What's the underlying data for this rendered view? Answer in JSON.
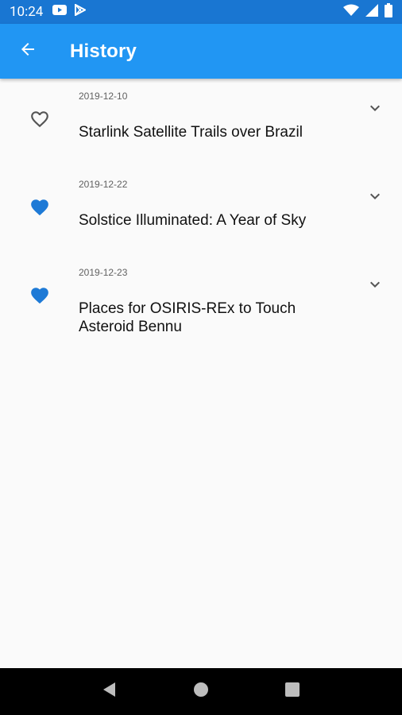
{
  "status_bar": {
    "time": "10:24",
    "left_icons": [
      "youtube-icon",
      "play-store-icon"
    ],
    "right_icons": [
      "wifi-icon",
      "signal-icon",
      "battery-icon"
    ]
  },
  "app_bar": {
    "title": "History",
    "back_icon": "arrow-back-icon",
    "color": "#2196f3"
  },
  "history": [
    {
      "date": "2019-12-10",
      "title": "Starlink Satellite Trails over Brazil",
      "favorited": false
    },
    {
      "date": "2019-12-22",
      "title": "Solstice Illuminated: A Year of Sky",
      "favorited": true
    },
    {
      "date": "2019-12-23",
      "title": "Places for OSIRIS-REx to Touch Asteroid Bennu",
      "favorited": true
    }
  ],
  "nav_bar": {
    "buttons": [
      "back-triangle-icon",
      "home-circle-icon",
      "recents-square-icon"
    ]
  },
  "colors": {
    "status_bar": "#1976d2",
    "accent": "#1e7ad6",
    "background": "#fafafa"
  }
}
